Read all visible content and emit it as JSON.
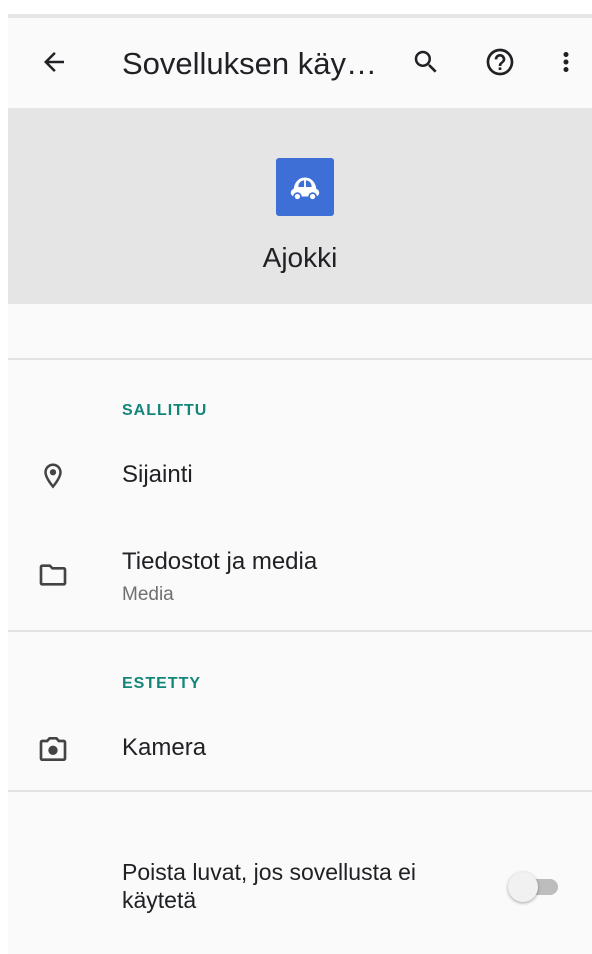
{
  "toolbar": {
    "title": "Sovelluksen käy…",
    "back_icon": "arrow-back-icon",
    "search_icon": "search-icon",
    "help_icon": "help-circle-icon",
    "more_icon": "more-vert-icon"
  },
  "app": {
    "name": "Ajokki",
    "icon": "car-icon",
    "icon_color": "#3e6fd6"
  },
  "sections": {
    "allowed": {
      "label": "SALLITTU",
      "items": [
        {
          "label": "Sijainti",
          "icon": "location-pin-icon"
        },
        {
          "label": "Tiedostot ja media",
          "subtitle": "Media",
          "icon": "folder-icon"
        }
      ]
    },
    "denied": {
      "label": "ESTETTY",
      "items": [
        {
          "label": "Kamera",
          "icon": "camera-icon"
        }
      ]
    }
  },
  "auto_revoke": {
    "label": "Poista luvat, jos sovellusta ei käytetä",
    "enabled": false
  },
  "colors": {
    "accent": "#13867a",
    "header_bg": "#e5e5e5"
  }
}
